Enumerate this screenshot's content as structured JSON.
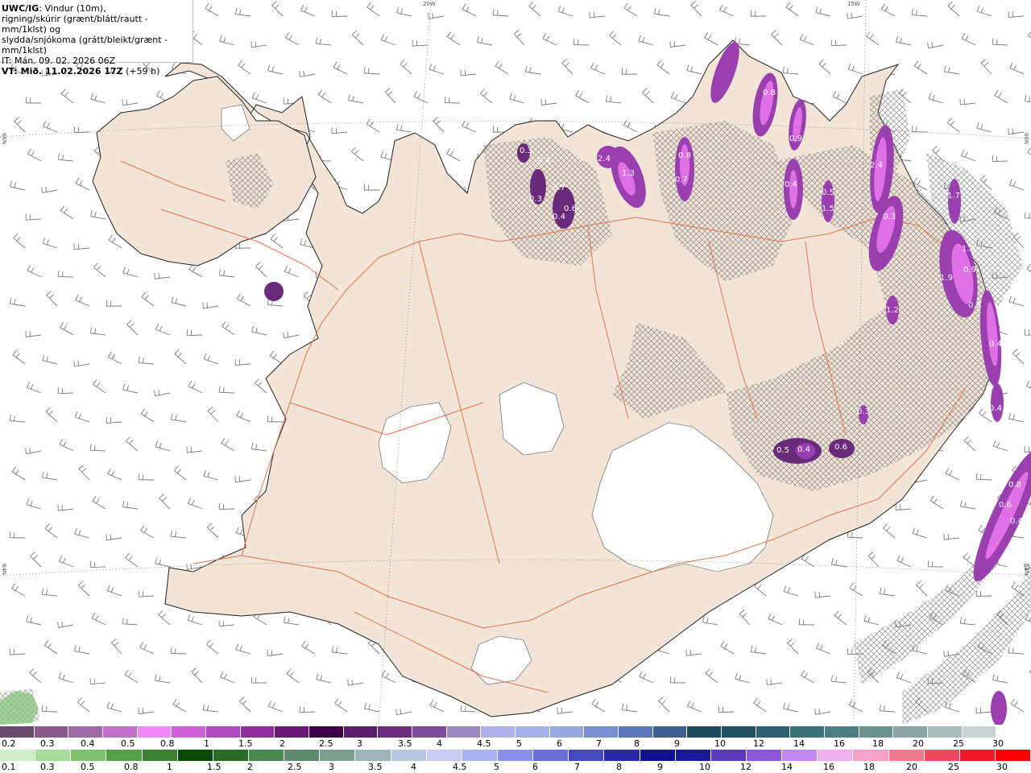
{
  "info": {
    "model": "UWC/IG",
    "line1": ": Vindur (10m),",
    "line2": "rigning/skúrir (grænt/blátt/rautt - mm/1klst) og",
    "line3": "slydda/snjókoma (grátt/bleikt/grænt - mm/1klst)",
    "issue_time": "IT: Mán. 09. 02. 2026 06Z",
    "valid_time": "VT: Mið. 11.02.2026 17Z",
    "lead": "(+59 h)"
  },
  "grid_labels": {
    "lon_20w": "20W",
    "lon_15w": "15W",
    "lat_66n_left": "66N",
    "lat_66n_right": "66N",
    "lat_64n_left": "64N",
    "lat_64n_right": "64N"
  },
  "colors": {
    "land": "#f2e4d6",
    "coast": "#222222",
    "roads": "#e8744a",
    "glacier": "#ffffff",
    "wind_barb": "#7a7a7a",
    "snow_purple_dark": "#5c2d6e",
    "snow_purple": "#9a3fb0",
    "snow_magenta": "#e070e8"
  },
  "map_values": [
    {
      "v": "0.3"
    },
    {
      "v": "0.4"
    },
    {
      "v": "0.7"
    },
    {
      "v": "0.3"
    },
    {
      "v": "0.4"
    },
    {
      "v": "0.6"
    },
    {
      "v": "2.4"
    },
    {
      "v": "1.3"
    },
    {
      "v": "0.8"
    },
    {
      "v": "0.7"
    },
    {
      "v": "0.8"
    },
    {
      "v": "0.9"
    },
    {
      "v": "0.4"
    },
    {
      "v": "0.5"
    },
    {
      "v": "1.5"
    },
    {
      "v": "2.4"
    },
    {
      "v": "0.3"
    },
    {
      "v": "1.7"
    },
    {
      "v": "1.2"
    },
    {
      "v": "1.9"
    },
    {
      "v": "0.9"
    },
    {
      "v": "0.3"
    },
    {
      "v": "1.2"
    },
    {
      "v": "0.4"
    },
    {
      "v": "0.4"
    },
    {
      "v": "0.3"
    },
    {
      "v": "0.5"
    },
    {
      "v": "0.4"
    },
    {
      "v": "0.6"
    },
    {
      "v": "0.8"
    },
    {
      "v": "0.6"
    },
    {
      "v": "0.4"
    }
  ],
  "scale_snow": {
    "colors": [
      "#6a4a6e",
      "#8a5a8e",
      "#a06aa6",
      "#c070c8",
      "#f088f8",
      "#d060d8",
      "#b048c0",
      "#902ea0",
      "#6a1878",
      "#40004a",
      "#5a1e6a",
      "#6e2e80",
      "#7e4e98",
      "#9a8ac0",
      "#b0b0e8",
      "#a8b0e8",
      "#9aa8e0",
      "#7890d0",
      "#5a78b8",
      "#3e5e90",
      "#1e4a60",
      "#1e5260",
      "#2a6070",
      "#3a7078",
      "#507e84",
      "#6a9090",
      "#8aa4a6",
      "#a8bcbc",
      "#c8d4d4",
      "#ffffff"
    ],
    "labels": [
      "0.2",
      "0.3",
      "0.4",
      "0.5",
      "0.8",
      "1",
      "1.5",
      "2",
      "2.5",
      "3",
      "3.5",
      "4",
      "4.5",
      "5",
      "6",
      "7",
      "8",
      "9",
      "10",
      "12",
      "14",
      "16",
      "18",
      "20",
      "25",
      "30"
    ]
  },
  "scale_rain": {
    "colors": [
      "#cfeec8",
      "#a8dc9c",
      "#7cc070",
      "#56a048",
      "#3a8030",
      "#0a4a0a",
      "#2a6a2a",
      "#4a8a50",
      "#5e8a6e",
      "#7a9e90",
      "#9ab4b8",
      "#b8c8e0",
      "#c8ccf4",
      "#a8b0f0",
      "#8890e8",
      "#6a70d8",
      "#4848c0",
      "#2828a8",
      "#101090",
      "#1818a0",
      "#5a38c0",
      "#8a58d8",
      "#c088f0",
      "#f0b0f0",
      "#f8a0c8",
      "#f07890",
      "#f04860",
      "#f01828",
      "#ff0000"
    ],
    "labels": [
      "0.1",
      "0.3",
      "0.5",
      "0.8",
      "1",
      "1.5",
      "2",
      "2.5",
      "3",
      "3.5",
      "4",
      "4.5",
      "5",
      "6",
      "7",
      "8",
      "9",
      "10",
      "12",
      "14",
      "16",
      "18",
      "20",
      "25",
      "30"
    ]
  }
}
